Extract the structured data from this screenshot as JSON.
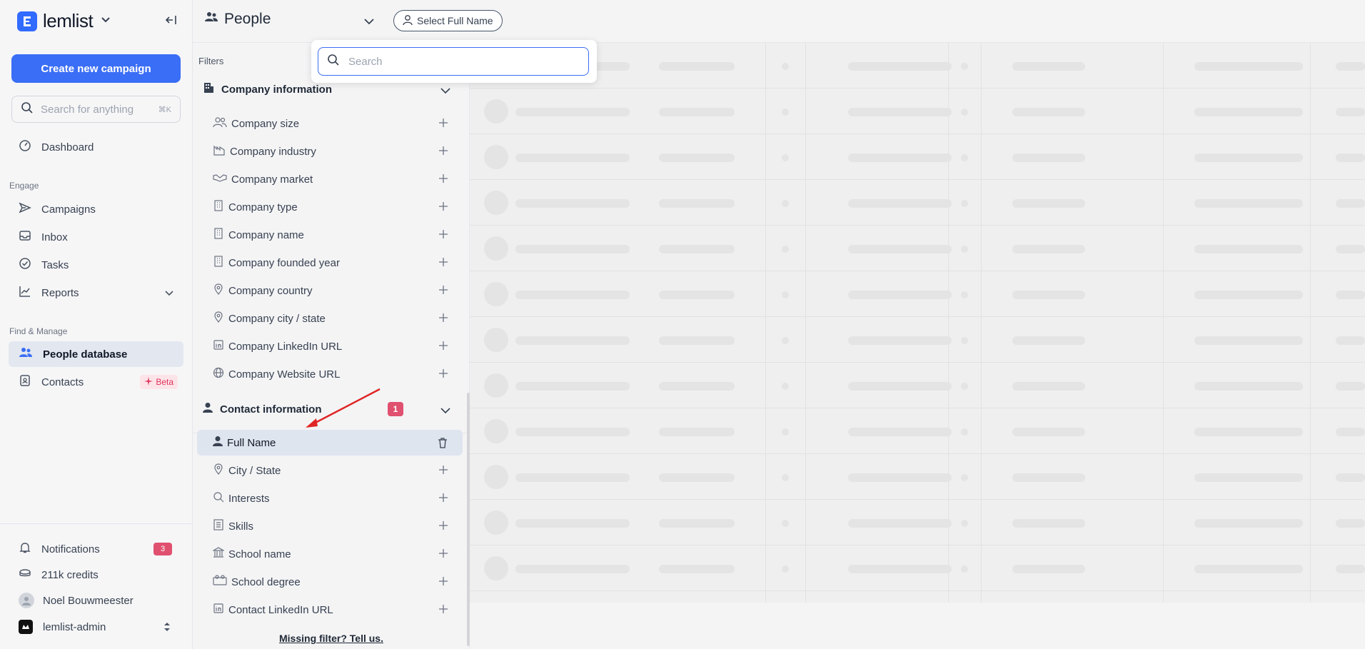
{
  "brand": {
    "name": "lemlist",
    "accent": "#316bff"
  },
  "sidebar": {
    "create_label": "Create new campaign",
    "search_placeholder": "Search for anything",
    "search_shortcut": "⌘K",
    "dashboard": "Dashboard",
    "engage_label": "Engage",
    "engage_items": [
      {
        "label": "Campaigns",
        "icon": "send-icon"
      },
      {
        "label": "Inbox",
        "icon": "inbox-icon"
      },
      {
        "label": "Tasks",
        "icon": "check-circle-icon"
      },
      {
        "label": "Reports",
        "icon": "chart-icon"
      }
    ],
    "manage_label": "Find & Manage",
    "manage_items": [
      {
        "label": "People database",
        "icon": "people-icon",
        "active": true
      },
      {
        "label": "Contacts",
        "icon": "contact-card-icon",
        "badge": "Beta"
      }
    ],
    "bottom": {
      "notifications": "Notifications",
      "notifications_count": "3",
      "credits": "211k credits",
      "user": "Noel Bouwmeester",
      "org": "lemlist-admin"
    }
  },
  "header": {
    "title": "People",
    "filter_chip": "Select Full Name"
  },
  "search_dropdown": {
    "placeholder": "Search"
  },
  "filters": {
    "label": "Filters",
    "company_group": {
      "title": "Company information",
      "items": [
        {
          "label": "Company size",
          "icon": "people-icon"
        },
        {
          "label": "Company industry",
          "icon": "industry-icon"
        },
        {
          "label": "Company market",
          "icon": "handshake-icon"
        },
        {
          "label": "Company type",
          "icon": "building-icon"
        },
        {
          "label": "Company name",
          "icon": "building-icon"
        },
        {
          "label": "Company founded year",
          "icon": "building-icon"
        },
        {
          "label": "Company country",
          "icon": "pin-icon"
        },
        {
          "label": "Company city / state",
          "icon": "pin-icon"
        },
        {
          "label": "Company LinkedIn URL",
          "icon": "linkedin-icon"
        },
        {
          "label": "Company Website URL",
          "icon": "globe-icon"
        }
      ]
    },
    "contact_group": {
      "title": "Contact information",
      "count": "1",
      "items": [
        {
          "label": "Full Name",
          "icon": "person-icon",
          "selected": true
        },
        {
          "label": "City / State",
          "icon": "pin-icon"
        },
        {
          "label": "Interests",
          "icon": "search-icon"
        },
        {
          "label": "Skills",
          "icon": "list-icon"
        },
        {
          "label": "School name",
          "icon": "school-icon"
        },
        {
          "label": "School degree",
          "icon": "degree-icon"
        },
        {
          "label": "Contact LinkedIn URL",
          "icon": "linkedin-icon"
        }
      ]
    },
    "missing_link": "Missing filter? Tell us."
  }
}
